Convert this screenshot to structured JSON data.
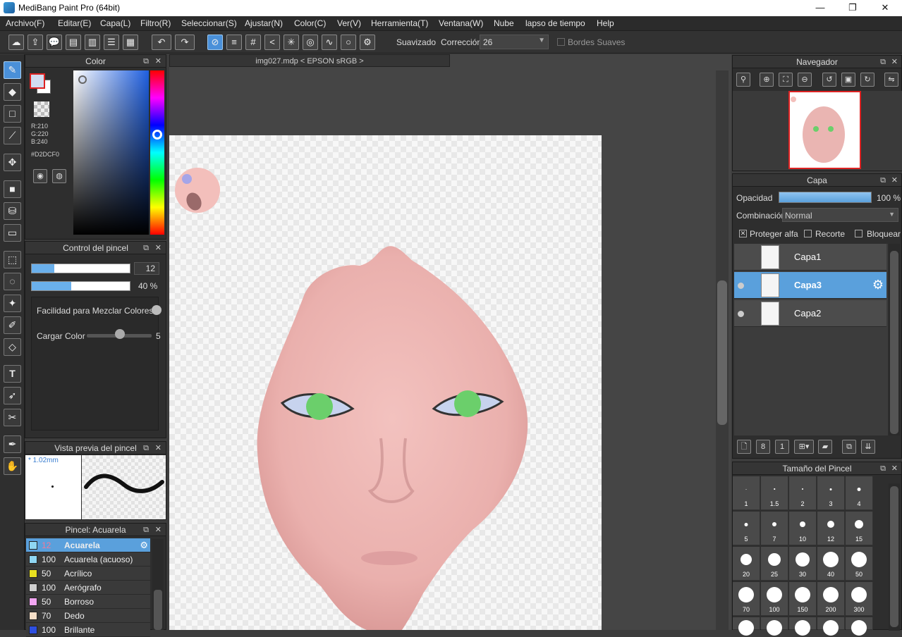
{
  "window": {
    "title": "MediBang Paint Pro (64bit)",
    "minimize": "—",
    "maximize": "❐",
    "close": "✕"
  },
  "menu": [
    "Archivo(F)",
    "Editar(E)",
    "Capa(L)",
    "Filtro(R)",
    "Seleccionar(S)",
    "Ajustar(N)",
    "Color(C)",
    "Ver(V)",
    "Herramienta(T)",
    "Ventana(W)",
    "Nube",
    "lapso de tiempo",
    "Help"
  ],
  "toolbar": {
    "smoothing_label": "Suavizado",
    "correction_label": "Corrección",
    "correction_value": "26",
    "soft_edges_label": "Bordes Suaves",
    "smoothing_checked": "✕"
  },
  "color_panel": {
    "title": "Color",
    "r": "R:210",
    "g": "G:220",
    "b": "B:240",
    "hex": "#D2DCF0",
    "fg": "#D2DCF0"
  },
  "brush_control": {
    "title": "Control del pincel",
    "size_value": "12",
    "opacity_value": "40 %",
    "blend_label": "Facilidad para Mezclar Colores",
    "load_label": "Cargar Color",
    "load_value": "5"
  },
  "brush_preview": {
    "title": "Vista previa del pincel",
    "size": "* 1.02mm"
  },
  "brush_list": {
    "title": "Pincel: Acuarela",
    "items": [
      {
        "num": "12",
        "name": "Acuarela",
        "color": "#8fd6f2",
        "selected": true
      },
      {
        "num": "100",
        "name": "Acuarela (acuoso)",
        "color": "#8fd6f2"
      },
      {
        "num": "50",
        "name": "Acrílico",
        "color": "#e8e020"
      },
      {
        "num": "100",
        "name": "Aerógrafo",
        "color": "#cfcfcf"
      },
      {
        "num": "50",
        "name": "Borroso",
        "color": "#f2a6f2"
      },
      {
        "num": "70",
        "name": "Dedo",
        "color": "#f5dfc8"
      },
      {
        "num": "100",
        "name": "Brillante",
        "color": "#2d4fe0"
      }
    ]
  },
  "document": {
    "tab": "img027.mdp < EPSON  sRGB >"
  },
  "navigator": {
    "title": "Navegador"
  },
  "layers": {
    "title": "Capa",
    "opacity_label": "Opacidad",
    "opacity_value": "100 %",
    "blend_label": "Combinación",
    "blend_value": "Normal",
    "protect_alpha": "Proteger alfa",
    "clip": "Recorte",
    "lock": "Bloquear",
    "items": [
      {
        "name": "Capa1",
        "visible": false,
        "selected": false
      },
      {
        "name": "Capa3",
        "visible": true,
        "selected": true
      },
      {
        "name": "Capa2",
        "visible": true,
        "selected": false
      }
    ]
  },
  "brush_size": {
    "title": "Tamaño del Pincel",
    "sizes": [
      "1",
      "1.5",
      "2",
      "3",
      "4",
      "5",
      "7",
      "10",
      "12",
      "15",
      "20",
      "25",
      "30",
      "40",
      "50",
      "70",
      "100",
      "150",
      "200",
      "300"
    ]
  }
}
